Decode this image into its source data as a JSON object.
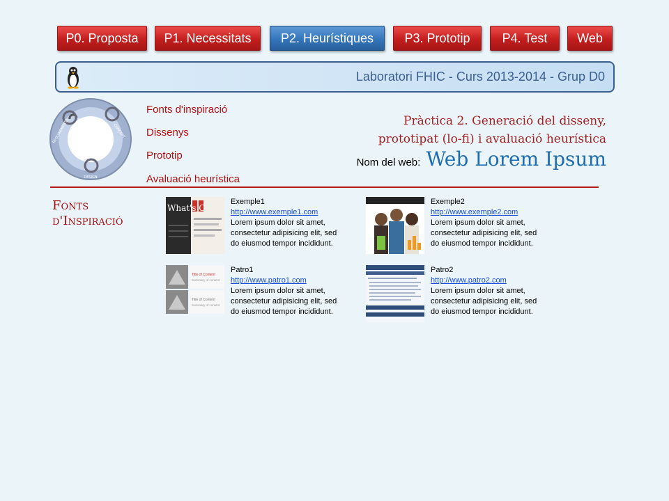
{
  "nav": {
    "items": [
      {
        "label": "P0. Proposta",
        "active": false
      },
      {
        "label": "P1. Necessitats",
        "active": false
      },
      {
        "label": "P2. Heurístiques",
        "active": true
      },
      {
        "label": "P3. Prototip",
        "active": false
      },
      {
        "label": "P4. Test",
        "active": false
      },
      {
        "label": "Web",
        "active": false
      }
    ]
  },
  "banner": {
    "title": "Laboratori FHIC - Curs 2013-2014 - Grup D0",
    "logo_icon": "penguin-icon"
  },
  "cycle": {
    "labels": [
      "EVALUATION",
      "DESIGN",
      "REQUIREMENTS",
      "CONCEPT"
    ]
  },
  "menu": {
    "items": [
      "Fonts d'inspiració",
      "Dissenys",
      "Prototip",
      "Avaluació heurística"
    ]
  },
  "heading": {
    "line1": "Pràctica 2. Generació del disseny,",
    "line2": "prototipat (lo-fi) i avaluació heurística",
    "web_label": "Nom del web:",
    "web_name": "Web Lorem Ipsum"
  },
  "section": {
    "title": "Fonts d'Inspiració"
  },
  "cards": [
    {
      "name": "Exemple1",
      "url": "http://www.exemple1.com",
      "desc1": "Lorem ipsum dolor sit amet,",
      "desc2": "consectetur adipisicing elit, sed",
      "desc3": "do eiusmod tempor  incididunt.",
      "thumb_text": "What's C"
    },
    {
      "name": "Exemple2",
      "url": "http://www.exemple2.com",
      "desc1": "Lorem ipsum dolor sit amet,",
      "desc2": "consectetur adipisicing elit, sed",
      "desc3": "do eiusmod tempor  incididunt."
    },
    {
      "name": "Patro1",
      "url": "http://www.patro1.com",
      "desc1": "Lorem ipsum dolor sit amet,",
      "desc2": "consectetur adipisicing elit, sed",
      "desc3": "do eiusmod tempor  incididunt.",
      "thumb_title": "Title of Content",
      "thumb_sub": "Summary of content"
    },
    {
      "name": "Patro2",
      "url": "http://www.patro2.com",
      "desc1": "Lorem ipsum dolor sit amet,",
      "desc2": "consectetur adipisicing elit, sed",
      "desc3": "do eiusmod tempor  incididunt."
    }
  ],
  "colors": {
    "nav_red": "#c31e1e",
    "nav_active_blue": "#3475bb",
    "accent_red": "#b31010",
    "web_name_blue": "#1e6db0",
    "background": "#eaf4f9"
  }
}
